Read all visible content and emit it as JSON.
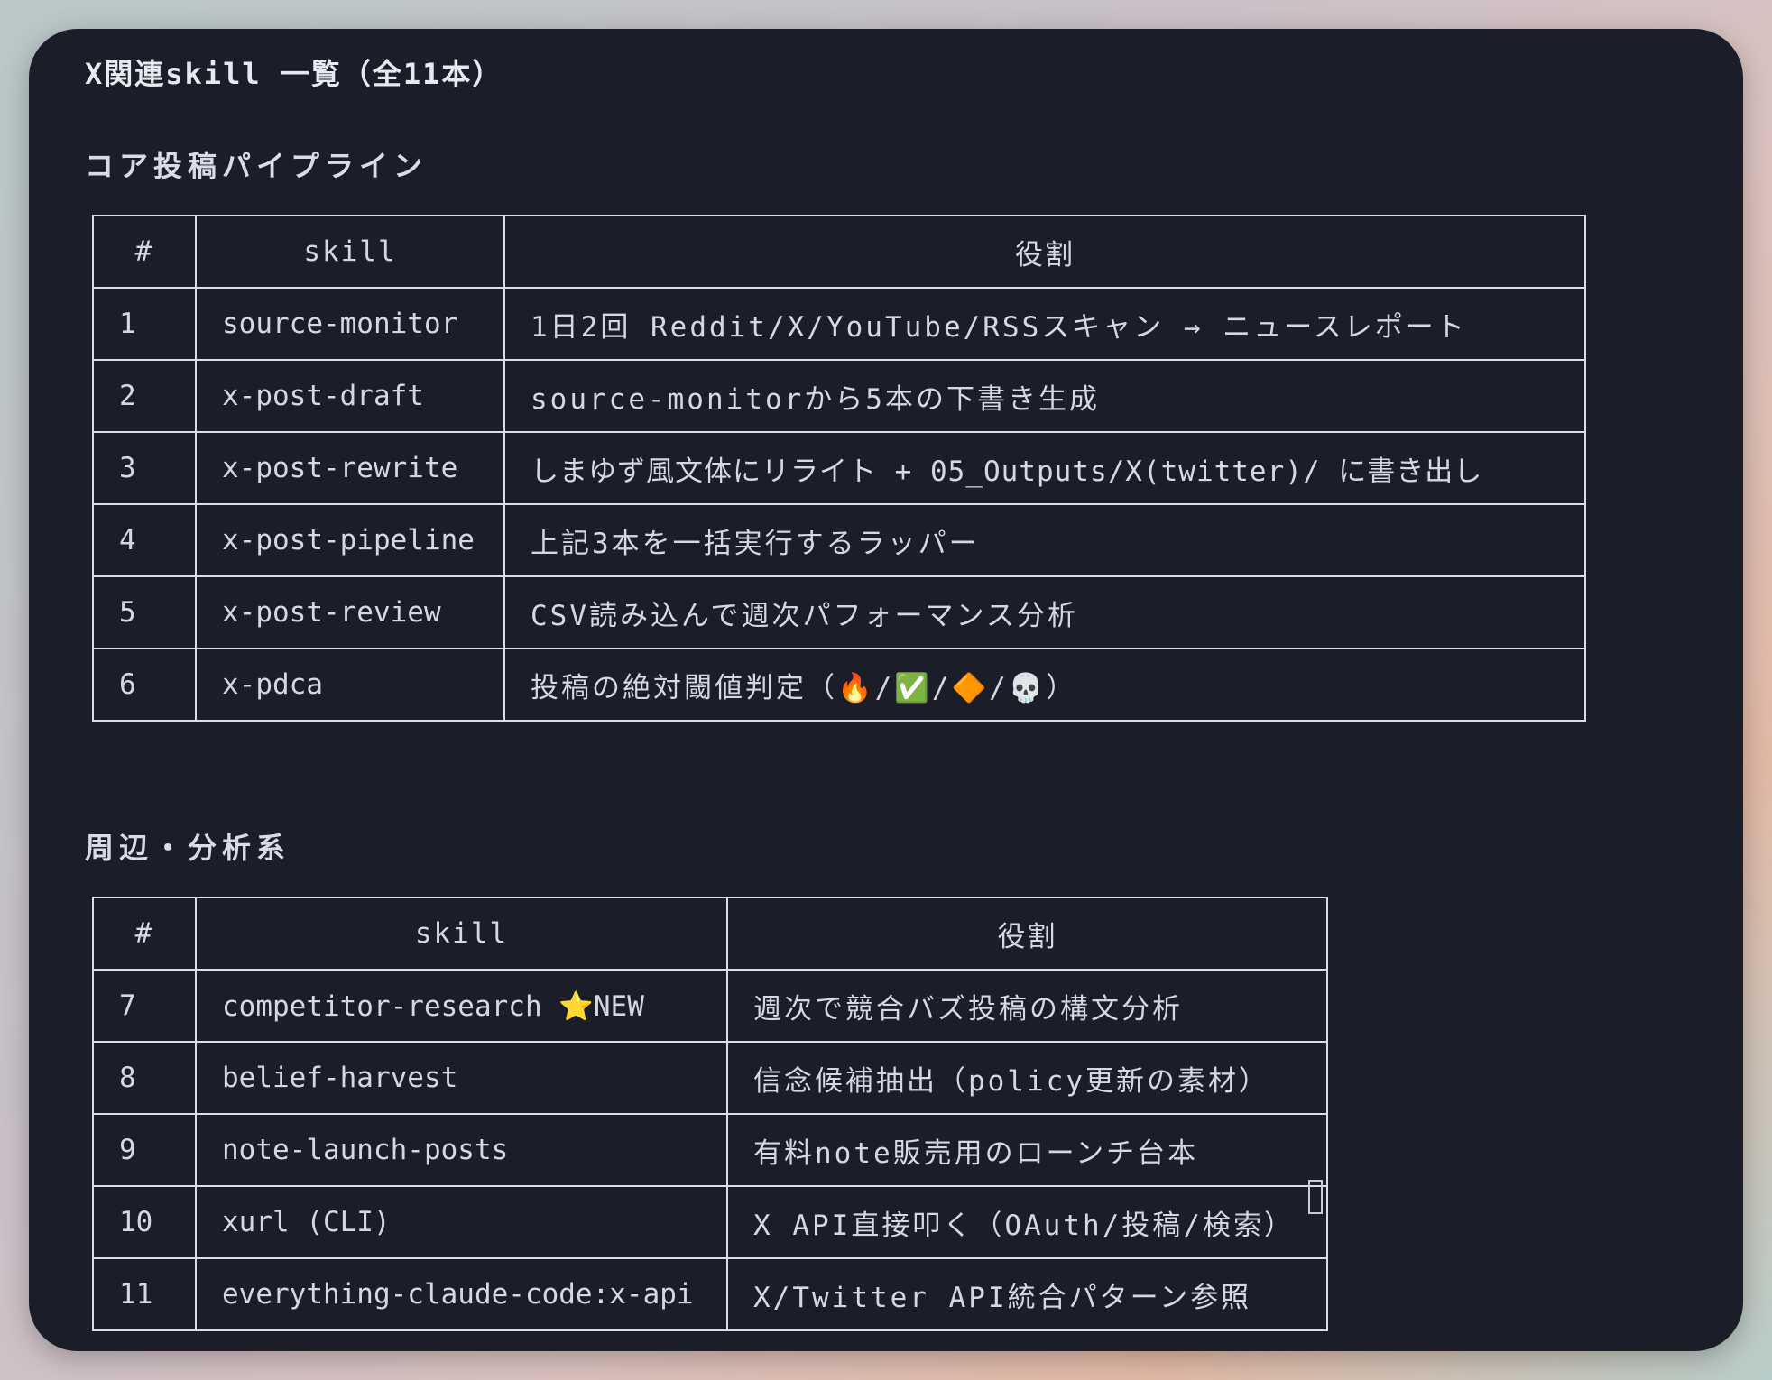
{
  "document": {
    "title": "X関連skill 一覧（全11本）"
  },
  "sections": [
    {
      "heading": "コア投稿パイプライン",
      "columns": [
        "#",
        "skill",
        "役割"
      ],
      "rows": [
        {
          "num": "1",
          "skill": "source-monitor",
          "role": "1日2回 Reddit/X/YouTube/RSSスキャン → ニュースレポート"
        },
        {
          "num": "2",
          "skill": "x-post-draft",
          "role": "source-monitorから5本の下書き生成"
        },
        {
          "num": "3",
          "skill": "x-post-rewrite",
          "role": "しまゆず風文体にリライト + 05_Outputs/X(twitter)/ に書き出し"
        },
        {
          "num": "4",
          "skill": "x-post-pipeline",
          "role": "上記3本を一括実行するラッパー"
        },
        {
          "num": "5",
          "skill": "x-post-review",
          "role": "CSV読み込んで週次パフォーマンス分析"
        },
        {
          "num": "6",
          "skill": "x-pdca",
          "role": "投稿の絶対閾値判定（🔥/✅/🔶/💀）"
        }
      ]
    },
    {
      "heading": "周辺・分析系",
      "columns": [
        "#",
        "skill",
        "役割"
      ],
      "rows": [
        {
          "num": "7",
          "skill": "competitor-research ⭐NEW",
          "role": "週次で競合バズ投稿の構文分析"
        },
        {
          "num": "8",
          "skill": "belief-harvest",
          "role": "信念候補抽出（policy更新の素材）"
        },
        {
          "num": "9",
          "skill": "note-launch-posts",
          "role": "有料note販売用のローンチ台本"
        },
        {
          "num": "10",
          "skill": "xurl (CLI)",
          "role": "X API直接叩く（OAuth/投稿/検索）"
        },
        {
          "num": "11",
          "skill": "everything-claude-code:x-api",
          "role": "X/Twitter API統合パターン参照"
        }
      ]
    }
  ]
}
